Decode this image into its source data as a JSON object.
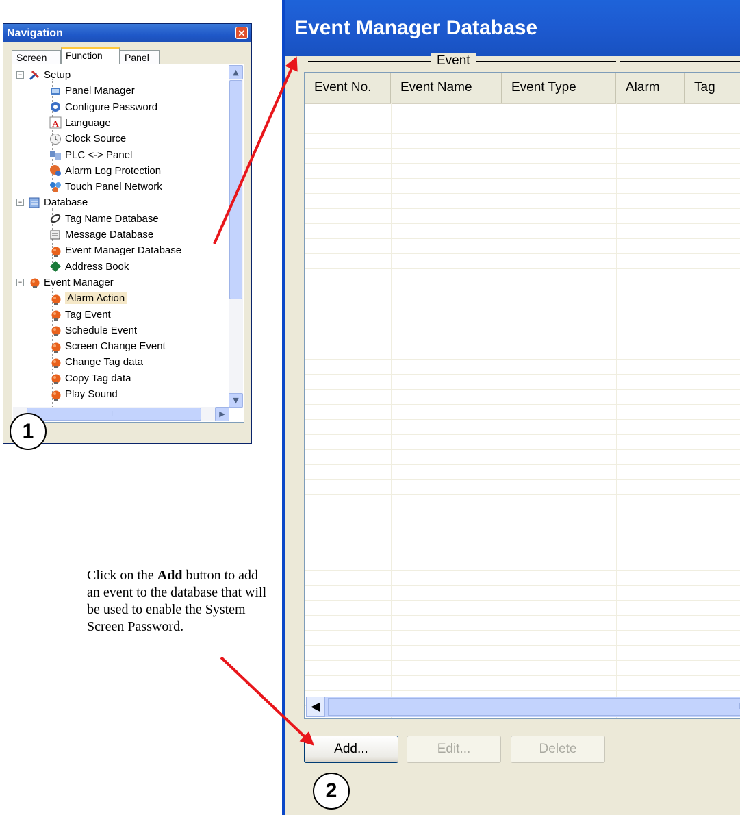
{
  "navigation": {
    "title": "Navigation",
    "close_glyph": "✕",
    "tabs": [
      "Screen",
      "Function",
      "Panel"
    ],
    "active_tab": "Function",
    "tree": [
      {
        "label": "Setup",
        "level": 0,
        "expander": "−",
        "icon": "tools-icon"
      },
      {
        "label": "Panel Manager",
        "level": 1,
        "icon": "panel-manager-icon"
      },
      {
        "label": "Configure Password",
        "level": 1,
        "icon": "password-icon"
      },
      {
        "label": "Language",
        "level": 1,
        "icon": "language-icon"
      },
      {
        "label": "Clock Source",
        "level": 1,
        "icon": "clock-icon"
      },
      {
        "label": "PLC <-> Panel",
        "level": 1,
        "icon": "plc-panel-icon"
      },
      {
        "label": "Alarm Log Protection",
        "level": 1,
        "icon": "alarm-log-icon"
      },
      {
        "label": "Touch Panel Network",
        "level": 1,
        "icon": "network-icon"
      },
      {
        "label": "Database",
        "level": 0,
        "expander": "−",
        "icon": "database-icon"
      },
      {
        "label": "Tag Name Database",
        "level": 1,
        "icon": "tag-database-icon"
      },
      {
        "label": "Message Database",
        "level": 1,
        "icon": "message-database-icon"
      },
      {
        "label": "Event Manager Database",
        "level": 1,
        "icon": "event-bulb-icon"
      },
      {
        "label": "Address Book",
        "level": 1,
        "icon": "address-book-icon"
      },
      {
        "label": "Event Manager",
        "level": 0,
        "expander": "−",
        "icon": "event-bulb-icon"
      },
      {
        "label": "Alarm Action",
        "level": 1,
        "icon": "event-bulb-icon",
        "selected": true
      },
      {
        "label": "Tag Event",
        "level": 1,
        "icon": "event-bulb-icon"
      },
      {
        "label": "Schedule Event",
        "level": 1,
        "icon": "event-bulb-icon"
      },
      {
        "label": "Screen Change Event",
        "level": 1,
        "icon": "event-bulb-icon"
      },
      {
        "label": "Change Tag data",
        "level": 1,
        "icon": "event-bulb-icon"
      },
      {
        "label": "Copy Tag data",
        "level": 1,
        "icon": "event-bulb-icon"
      },
      {
        "label": "Play Sound",
        "level": 1,
        "icon": "event-bulb-icon"
      }
    ],
    "scroll_up": "▲",
    "scroll_down": "▼",
    "scroll_right": "▶",
    "thumb_grip": "III"
  },
  "event_manager": {
    "title": "Event Manager Database",
    "group_label": "Event",
    "columns": [
      "Event No.",
      "Event Name",
      "Event Type",
      "Alarm",
      "Tag"
    ],
    "rows": [],
    "scroll_left": "◀",
    "thumb_grip": "III",
    "buttons": {
      "add": "Add...",
      "edit": "Edit...",
      "delete": "Delete"
    }
  },
  "markers": {
    "one": "1",
    "two": "2"
  },
  "caption": {
    "before": "Click on the ",
    "bold": "Add",
    "after": " button to add an event to the database that will be used to enable the System Screen Password."
  },
  "colors": {
    "arrow": "#e8161b",
    "titlebar": "#1d5ad0",
    "window_bg": "#ece9d8"
  }
}
